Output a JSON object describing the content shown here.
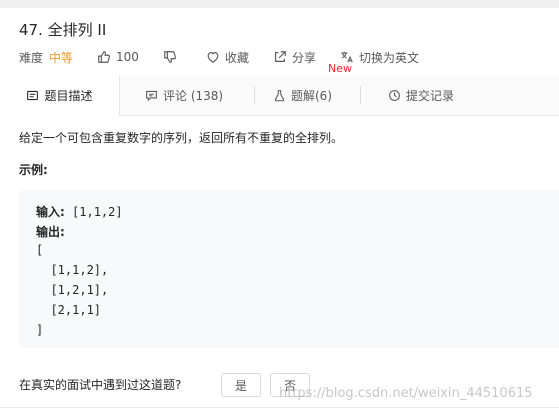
{
  "problem": {
    "title": "47. 全排列 II",
    "difficulty_label": "难度",
    "difficulty_value": "中等",
    "likes": "100",
    "favorite_label": "收藏",
    "share_label": "分享",
    "switch_lang_label": "切换为英文"
  },
  "colors": {
    "difficulty_medium": "#ef9b23",
    "new_badge": "#f5222d"
  },
  "tabs": [
    {
      "label": "题目描述",
      "icon": "description-icon",
      "active": true
    },
    {
      "label": "评论 (138)",
      "icon": "comment-icon"
    },
    {
      "label": "题解(6)",
      "icon": "flask-icon",
      "badge": "New"
    },
    {
      "label": "提交记录",
      "icon": "clock-icon"
    }
  ],
  "content": {
    "description": "给定一个可包含重复数字的序列，返回所有不重复的全排列。",
    "example_title": "示例:",
    "input_label": "输入:",
    "input_value": " [1,1,2]",
    "output_label": "输出:",
    "output_lines": [
      "[",
      "  [1,1,2],",
      "  [1,2,1],",
      "  [2,1,1]",
      "]"
    ]
  },
  "feedback": {
    "question": "在真实的面试中遇到过这道题?",
    "yes": "是",
    "no": "否"
  },
  "watermark": "https://blog.csdn.net/weixin_44510615"
}
